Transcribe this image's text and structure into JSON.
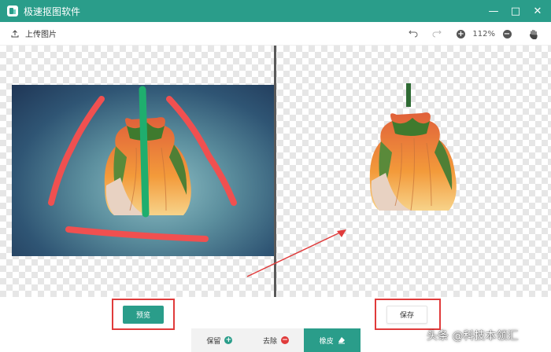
{
  "app": {
    "title": "极速抠图软件"
  },
  "window": {
    "minimize_symbol": "—",
    "maximize_symbol": "□",
    "close_symbol": "✕"
  },
  "toolbar": {
    "upload_label": "上传图片",
    "zoom_level": "112%",
    "zoom_in_symbol": "+",
    "zoom_out_symbol": "−"
  },
  "actions": {
    "preview_label": "预览",
    "save_label": "保存"
  },
  "modes": [
    {
      "label": "保留",
      "icon": "plus-circle-icon",
      "color": "#2a9d8a",
      "symbol": "+"
    },
    {
      "label": "去除",
      "icon": "minus-circle-icon",
      "color": "#e03b3b",
      "symbol": "−"
    },
    {
      "label": "橡皮",
      "icon": "eraser-icon",
      "active": true
    }
  ],
  "watermark": {
    "text": "头条 @科技本领汇"
  },
  "colors": {
    "accent": "#2a9d8a",
    "annotation_red": "#e03b3b",
    "keep_stroke": "#1fae6e",
    "remove_stroke": "#f05050"
  }
}
